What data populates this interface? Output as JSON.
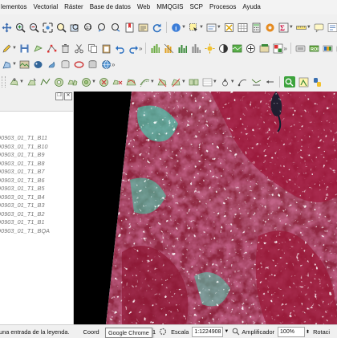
{
  "menubar": {
    "items": [
      "lementos",
      "Vectorial",
      "Ráster",
      "Base de datos",
      "Web",
      "MMQGIS",
      "SCP",
      "Procesos",
      "Ayuda"
    ]
  },
  "layers_panel": {
    "float_btn": "❐",
    "close_btn": "✕",
    "layers": [
      "90903_01_T1_B11",
      "90903_01_T1_B10",
      "90903_01_T1_B9",
      "90903_01_T1_B8",
      "90903_01_T1_B7",
      "90903_01_T1_B6",
      "90903_01_T1_B5",
      "90903_01_T1_B4",
      "90903_01_T1_B3",
      "90903_01_T1_B2",
      "90903_01_T1_B1",
      "90903_01_T1_BQA"
    ]
  },
  "statusbar": {
    "message": "una entrada de la leyenda.",
    "coord_label": "Coord",
    "coord_value": "7831",
    "scale_label": "Escala",
    "scale_value": "1:1224908",
    "magnifier_label": "Amplificador",
    "magnifier_value": "100%",
    "rotation_label": "Rotaci"
  },
  "tooltip": {
    "text": "Google Chrome"
  },
  "colors": {
    "vegetation_red": "#9a1b3a",
    "bare_cyan": "#49c3a6",
    "water_dark": "#0b1f2e"
  }
}
